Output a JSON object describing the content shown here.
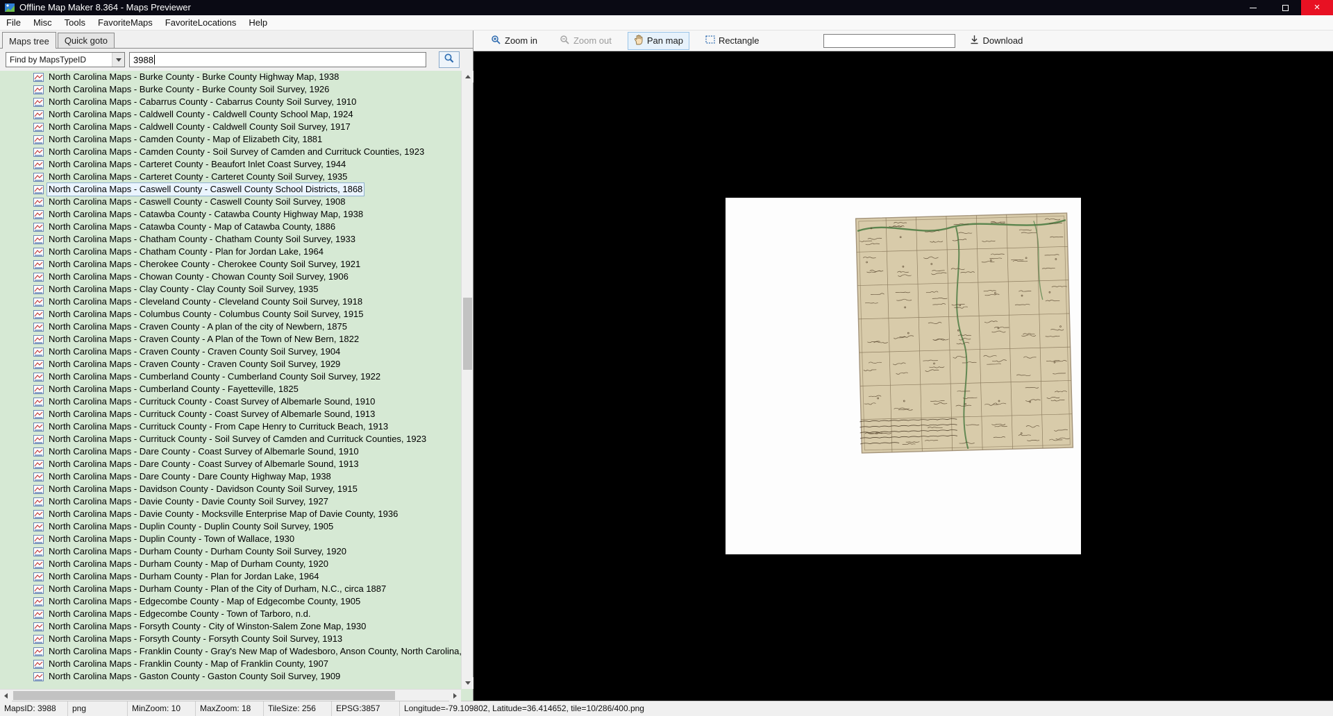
{
  "window": {
    "title": "Offline Map Maker 8.364 - Maps Previewer"
  },
  "menu": {
    "items": [
      "File",
      "Misc",
      "Tools",
      "FavoriteMaps",
      "FavoriteLocations",
      "Help"
    ]
  },
  "tabs": {
    "maps_tree": "Maps tree",
    "quick_goto": "Quick goto"
  },
  "search": {
    "filter_value": "Find by MapsTypeID",
    "query_value": "3988"
  },
  "toolbar": {
    "zoom_in": "Zoom in",
    "zoom_out": "Zoom out",
    "pan_map": "Pan map",
    "rectangle": "Rectangle",
    "input_value": "",
    "download": "Download"
  },
  "tree": {
    "selected_index": 9,
    "items": [
      "North Carolina Maps - Burke County - Burke County Highway Map, 1938",
      "North Carolina Maps - Burke County - Burke County Soil Survey, 1926",
      "North Carolina Maps - Cabarrus County - Cabarrus County Soil Survey, 1910",
      "North Carolina Maps - Caldwell County - Caldwell County School Map, 1924",
      "North Carolina Maps - Caldwell County - Caldwell County Soil Survey, 1917",
      "North Carolina Maps - Camden County - Map of Elizabeth City, 1881",
      "North Carolina Maps - Camden County - Soil Survey of Camden and Currituck Counties, 1923",
      "North Carolina Maps - Carteret County - Beaufort Inlet Coast Survey, 1944",
      "North Carolina Maps - Carteret County - Carteret County Soil Survey, 1935",
      "North Carolina Maps - Caswell County - Caswell County School Districts, 1868",
      "North Carolina Maps - Caswell County - Caswell County Soil Survey, 1908",
      "North Carolina Maps - Catawba County - Catawba County Highway Map, 1938",
      "North Carolina Maps - Catawba County - Map of Catawba County, 1886",
      "North Carolina Maps - Chatham County - Chatham County Soil Survey, 1933",
      "North Carolina Maps - Chatham County - Plan for Jordan Lake, 1964",
      "North Carolina Maps - Cherokee County - Cherokee County Soil Survey, 1921",
      "North Carolina Maps - Chowan County - Chowan County Soil Survey, 1906",
      "North Carolina Maps - Clay County - Clay County Soil Survey, 1935",
      "North Carolina Maps - Cleveland County - Cleveland County Soil Survey, 1918",
      "North Carolina Maps - Columbus County - Columbus County Soil Survey, 1915",
      "North Carolina Maps - Craven County - A plan of the city of Newbern, 1875",
      "North Carolina Maps - Craven County - A Plan of the Town of New Bern, 1822",
      "North Carolina Maps - Craven County - Craven County Soil Survey, 1904",
      "North Carolina Maps - Craven County - Craven County Soil Survey, 1929",
      "North Carolina Maps - Cumberland County - Cumberland County Soil Survey, 1922",
      "North Carolina Maps - Cumberland County - Fayetteville, 1825",
      "North Carolina Maps - Currituck County - Coast Survey of Albemarle Sound, 1910",
      "North Carolina Maps - Currituck County - Coast Survey of Albemarle Sound, 1913",
      "North Carolina Maps - Currituck County - From Cape Henry to Currituck Beach, 1913",
      "North Carolina Maps - Currituck County - Soil Survey of Camden and Currituck Counties, 1923",
      "North Carolina Maps - Dare County - Coast Survey of Albemarle Sound, 1910",
      "North Carolina Maps - Dare County - Coast Survey of Albemarle Sound, 1913",
      "North Carolina Maps - Dare County - Dare County Highway Map, 1938",
      "North Carolina Maps - Davidson County - Davidson County Soil Survey, 1915",
      "North Carolina Maps - Davie County - Davie County Soil Survey, 1927",
      "North Carolina Maps - Davie County - Mocksville Enterprise Map of Davie County, 1936",
      "North Carolina Maps - Duplin County - Duplin County Soil Survey, 1905",
      "North Carolina Maps - Duplin County - Town of Wallace, 1930",
      "North Carolina Maps - Durham County - Durham County Soil Survey, 1920",
      "North Carolina Maps - Durham County - Map of Durham County, 1920",
      "North Carolina Maps - Durham County - Plan for Jordan Lake, 1964",
      "North Carolina Maps - Durham County - Plan of the City of Durham, N.C., circa 1887",
      "North Carolina Maps - Edgecombe County - Map of Edgecombe County, 1905",
      "North Carolina Maps - Edgecombe County - Town of Tarboro, n.d.",
      "North Carolina Maps - Forsyth County - City of Winston-Salem Zone Map, 1930",
      "North Carolina Maps - Forsyth County - Forsyth County Soil Survey, 1913",
      "North Carolina Maps - Franklin County - Gray's New Map of Wadesboro, Anson County, North Carolina,",
      "North Carolina Maps - Franklin County - Map of Franklin County, 1907",
      "North Carolina Maps - Gaston County - Gaston County Soil Survey, 1909"
    ]
  },
  "statusbar": {
    "segments": [
      "MapsID: 3988",
      "png",
      "MinZoom: 10",
      "MaxZoom: 18",
      "TileSize: 256",
      "EPSG:3857",
      "Longitude=-79.109802, Latitude=36.414652, tile=10/286/400.png"
    ]
  },
  "colors": {
    "titlebar_bg": "#0a0a14",
    "close_button": "#e81123",
    "tree_bg": "#d6e9d4",
    "canvas_bg": "#000000",
    "pan_active_bg": "#e7f2fb",
    "parchment": "#d8cbaa",
    "river_green": "#4e7d44"
  }
}
